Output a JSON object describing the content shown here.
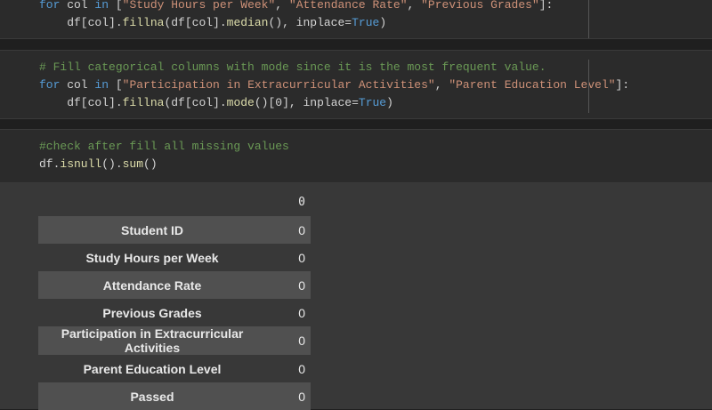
{
  "cells": [
    {
      "line1": {
        "for": "for",
        "col": " col ",
        "in": "in",
        "open": " [",
        "s1": "\"Study Hours per Week\"",
        "sep1": ", ",
        "s2": "\"Attendance Rate\"",
        "sep2": ", ",
        "s3": "\"Previous Grades\"",
        "close": "]:"
      },
      "line2": {
        "a": "    df[col].",
        "f1": "fillna",
        "b": "(df[col].",
        "f2": "median",
        "c": "(), inplace=",
        "t": "True",
        "d": ")"
      }
    },
    {
      "comment": "# Fill categorical columns with mode since it is the most frequent value.",
      "line1": {
        "for": "for",
        "col": " col ",
        "in": "in",
        "open": " [",
        "s1": "\"Participation in Extracurricular Activities\"",
        "sep1": ", ",
        "s2": "\"Parent Education Level\"",
        "close": "]:"
      },
      "line2": {
        "a": "    df[col].",
        "f1": "fillna",
        "b": "(df[col].",
        "f2": "mode",
        "c": "()[0], inplace=",
        "t": "True",
        "d": ")"
      }
    },
    {
      "comment": "#check after fill all missing values",
      "line1": {
        "a": "df.",
        "f1": "isnull",
        "b": "().",
        "f2": "sum",
        "c": "()"
      }
    }
  ],
  "output": {
    "column_header": "0",
    "rows": [
      {
        "label": "Student ID",
        "value": "0"
      },
      {
        "label": "Study Hours per Week",
        "value": "0"
      },
      {
        "label": "Attendance Rate",
        "value": "0"
      },
      {
        "label": "Previous Grades",
        "value": "0"
      },
      {
        "label": "Participation in Extracurricular Activities",
        "value": "0"
      },
      {
        "label": "Parent Education Level",
        "value": "0"
      },
      {
        "label": "Passed",
        "value": "0"
      }
    ]
  }
}
